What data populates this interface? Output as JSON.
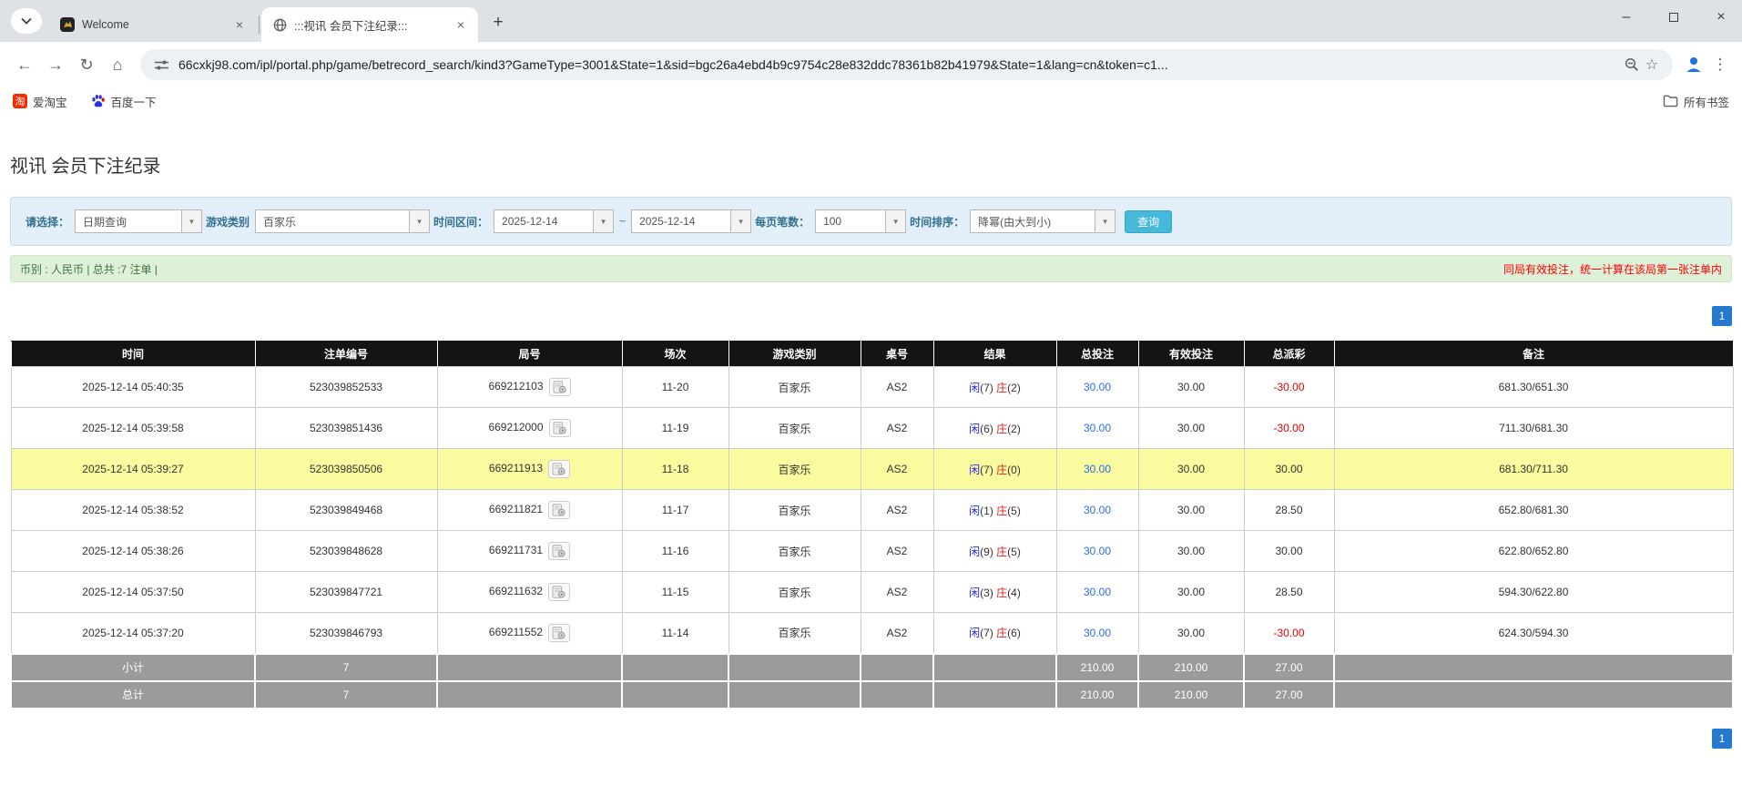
{
  "browser": {
    "tabs": [
      {
        "title": "Welcome"
      },
      {
        "title": ":::视讯 会员下注纪录:::"
      }
    ],
    "url": "66cxkj98.com/ipl/portal.php/game/betrecord_search/kind3?GameType=3001&State=1&sid=bgc26a4ebd4b9c9754c28e832ddc78361b82b41979&State=1&lang=cn&token=c1...",
    "bookmarks": [
      {
        "label": "爱淘宝",
        "icon_char": "淘"
      },
      {
        "label": "百度一下"
      }
    ],
    "all_bookmarks_label": "所有书签"
  },
  "icons": {
    "close": "×",
    "plus": "+",
    "minimize": "–",
    "back": "←",
    "forward": "→",
    "reload": "↻",
    "home": "⌂",
    "menu": "⋮",
    "star": "☆"
  },
  "page": {
    "title": "视讯 会员下注纪录",
    "filters": {
      "select_label": "请选择：",
      "select_value": "日期查询",
      "game_type_label": "游戏类别",
      "game_type_value": "百家乐",
      "date_range_label": "时间区间：",
      "date_from": "2025-12-14",
      "date_separator": "~",
      "date_to": "2025-12-14",
      "page_size_label": "每页笔数：",
      "page_size_value": "100",
      "sort_label": "时间排序：",
      "sort_value": "降幂(由大到小)",
      "query_button": "查询"
    },
    "info_bar": {
      "left": "币别 : 人民币 | 总共 :7 注单 |",
      "right": "同局有效投注，统一计算在该局第一张注单内"
    },
    "pagination": {
      "page": "1"
    },
    "table": {
      "headers": [
        "时间",
        "注单编号",
        "局号",
        "场次",
        "游戏类别",
        "桌号",
        "结果",
        "总投注",
        "有效投注",
        "总派彩",
        "备注"
      ],
      "rows": [
        {
          "time": "2025-12-14 05:40:35",
          "bet_id": "523039852533",
          "round_id": "669212103",
          "session": "11-20",
          "game": "百家乐",
          "table_no": "AS2",
          "result": {
            "player_label": "闲",
            "player_value": "(7)",
            "banker_label": "庄",
            "banker_value": "(2)"
          },
          "total_bet": "30.00",
          "valid_bet": "30.00",
          "payout": "-30.00",
          "remark": "681.30/651.30",
          "highlighted": false
        },
        {
          "time": "2025-12-14 05:39:58",
          "bet_id": "523039851436",
          "round_id": "669212000",
          "session": "11-19",
          "game": "百家乐",
          "table_no": "AS2",
          "result": {
            "player_label": "闲",
            "player_value": "(6)",
            "banker_label": "庄",
            "banker_value": "(2)"
          },
          "total_bet": "30.00",
          "valid_bet": "30.00",
          "payout": "-30.00",
          "remark": "711.30/681.30",
          "highlighted": false
        },
        {
          "time": "2025-12-14 05:39:27",
          "bet_id": "523039850506",
          "round_id": "669211913",
          "session": "11-18",
          "game": "百家乐",
          "table_no": "AS2",
          "result": {
            "player_label": "闲",
            "player_value": "(7)",
            "banker_label": "庄",
            "banker_value": "(0)"
          },
          "total_bet": "30.00",
          "valid_bet": "30.00",
          "payout": "30.00",
          "remark": "681.30/711.30",
          "highlighted": true
        },
        {
          "time": "2025-12-14 05:38:52",
          "bet_id": "523039849468",
          "round_id": "669211821",
          "session": "11-17",
          "game": "百家乐",
          "table_no": "AS2",
          "result": {
            "player_label": "闲",
            "player_value": "(1)",
            "banker_label": "庄",
            "banker_value": "(5)"
          },
          "total_bet": "30.00",
          "valid_bet": "30.00",
          "payout": "28.50",
          "remark": "652.80/681.30",
          "highlighted": false
        },
        {
          "time": "2025-12-14 05:38:26",
          "bet_id": "523039848628",
          "round_id": "669211731",
          "session": "11-16",
          "game": "百家乐",
          "table_no": "AS2",
          "result": {
            "player_label": "闲",
            "player_value": "(9)",
            "banker_label": "庄",
            "banker_value": "(5)"
          },
          "total_bet": "30.00",
          "valid_bet": "30.00",
          "payout": "30.00",
          "remark": "622.80/652.80",
          "highlighted": false
        },
        {
          "time": "2025-12-14 05:37:50",
          "bet_id": "523039847721",
          "round_id": "669211632",
          "session": "11-15",
          "game": "百家乐",
          "table_no": "AS2",
          "result": {
            "player_label": "闲",
            "player_value": "(3)",
            "banker_label": "庄",
            "banker_value": "(4)"
          },
          "total_bet": "30.00",
          "valid_bet": "30.00",
          "payout": "28.50",
          "remark": "594.30/622.80",
          "highlighted": false
        },
        {
          "time": "2025-12-14 05:37:20",
          "bet_id": "523039846793",
          "round_id": "669211552",
          "session": "11-14",
          "game": "百家乐",
          "table_no": "AS2",
          "result": {
            "player_label": "闲",
            "player_value": "(7)",
            "banker_label": "庄",
            "banker_value": "(6)"
          },
          "total_bet": "30.00",
          "valid_bet": "30.00",
          "payout": "-30.00",
          "remark": "624.30/594.30",
          "highlighted": false
        }
      ],
      "summary_rows": [
        {
          "label": "小计",
          "count": "7",
          "total_bet": "210.00",
          "valid_bet": "210.00",
          "payout": "27.00"
        },
        {
          "label": "总计",
          "count": "7",
          "total_bet": "210.00",
          "valid_bet": "210.00",
          "payout": "27.00"
        }
      ]
    }
  },
  "colors": {
    "accent_blue": "#2779d0",
    "header_bg": "#141414",
    "highlight_yellow": "#fafa9e",
    "success_bg": "#dff0d8",
    "success_text": "#3c763d",
    "alert_red": "#ff0000",
    "link_blue": "#2b6cf0",
    "player_blue": "#2222ee",
    "banker_red": "#e02020",
    "query_button_blue": "#46b8da",
    "summary_gray": "#9b9b9b"
  }
}
